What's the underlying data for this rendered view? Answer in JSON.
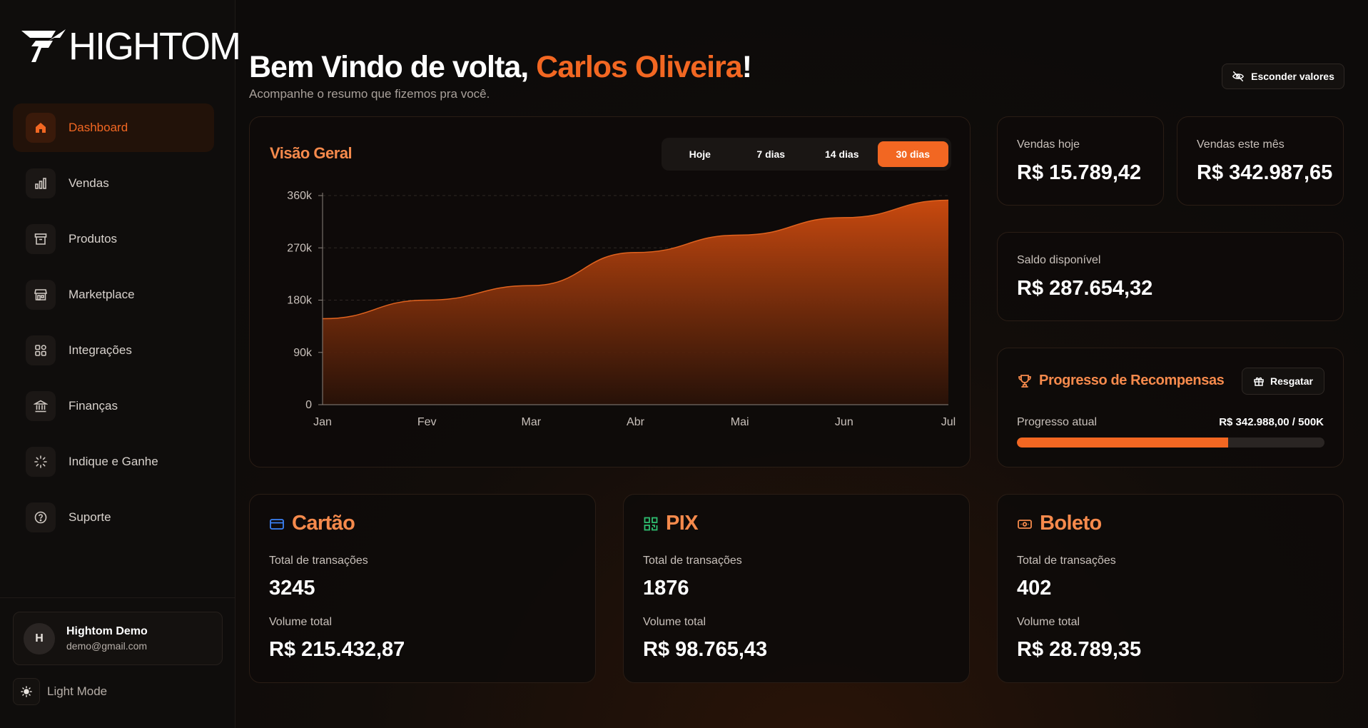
{
  "brand": {
    "name": "HIGHTOM"
  },
  "sidebar": {
    "items": [
      {
        "label": "Dashboard",
        "icon": "home-icon",
        "active": true
      },
      {
        "label": "Vendas",
        "icon": "bar-chart-icon"
      },
      {
        "label": "Produtos",
        "icon": "archive-icon"
      },
      {
        "label": "Marketplace",
        "icon": "store-icon"
      },
      {
        "label": "Integrações",
        "icon": "grid-icon"
      },
      {
        "label": "Finanças",
        "icon": "bank-icon"
      },
      {
        "label": "Indique e Ganhe",
        "icon": "sparkle-icon"
      },
      {
        "label": "Suporte",
        "icon": "help-icon"
      }
    ],
    "user": {
      "initial": "H",
      "name": "Hightom Demo",
      "email": "demo@gmail.com"
    },
    "mode_toggle": {
      "label": "Light Mode",
      "icon": "sun-icon"
    }
  },
  "header": {
    "greeting": "Bem Vindo de volta, ",
    "name": "Carlos Oliveira",
    "exclamation": "!",
    "subtitle": "Acompanhe o resumo que fizemos pra você.",
    "hide_values_label": "Esconder valores"
  },
  "overview": {
    "title": "Visão Geral",
    "ranges": [
      "Hoje",
      "7 dias",
      "14 dias",
      "30 dias"
    ],
    "active_range": "30 dias"
  },
  "chart_data": {
    "type": "area",
    "x": [
      "Jan",
      "Fev",
      "Mar",
      "Abr",
      "Mai",
      "Jun",
      "Jul"
    ],
    "values": [
      148000,
      180000,
      205000,
      262000,
      292000,
      322000,
      352000
    ],
    "ylim": [
      0,
      360000
    ],
    "yticks": [
      "0",
      "90k",
      "180k",
      "270k",
      "360k"
    ],
    "grid": true,
    "color": "#f26722"
  },
  "kpis": {
    "today": {
      "label": "Vendas hoje",
      "value": "R$ 15.789,42"
    },
    "month": {
      "label": "Vendas este mês",
      "value": "R$ 342.987,65"
    },
    "balance": {
      "label": "Saldo disponível",
      "value": "R$ 287.654,32"
    }
  },
  "rewards": {
    "title": "Progresso de Recompensas",
    "redeem_label": "Resgatar",
    "progress_label": "Progresso atual",
    "progress_value": "R$ 342.988,00 / 500K",
    "progress_fraction": 0.686
  },
  "payments": {
    "cartao": {
      "title": "Cartão",
      "icon": "credit-card-icon",
      "tx_label": "Total de transações",
      "tx_value": "3245",
      "vol_label": "Volume total",
      "vol_value": "R$ 215.432,87"
    },
    "pix": {
      "title": "PIX",
      "icon": "qr-code-icon",
      "tx_label": "Total de transações",
      "tx_value": "1876",
      "vol_label": "Volume total",
      "vol_value": "R$ 98.765,43"
    },
    "boleto": {
      "title": "Boleto",
      "icon": "cash-icon",
      "tx_label": "Total de transações",
      "tx_value": "402",
      "vol_label": "Volume total",
      "vol_value": "R$ 28.789,35"
    }
  },
  "colors": {
    "accent": "#f26722",
    "accent_light": "#f68a4c",
    "background": "#0d0b0a",
    "pix_green": "#2fbf71",
    "card_blue": "#3b82f6"
  }
}
